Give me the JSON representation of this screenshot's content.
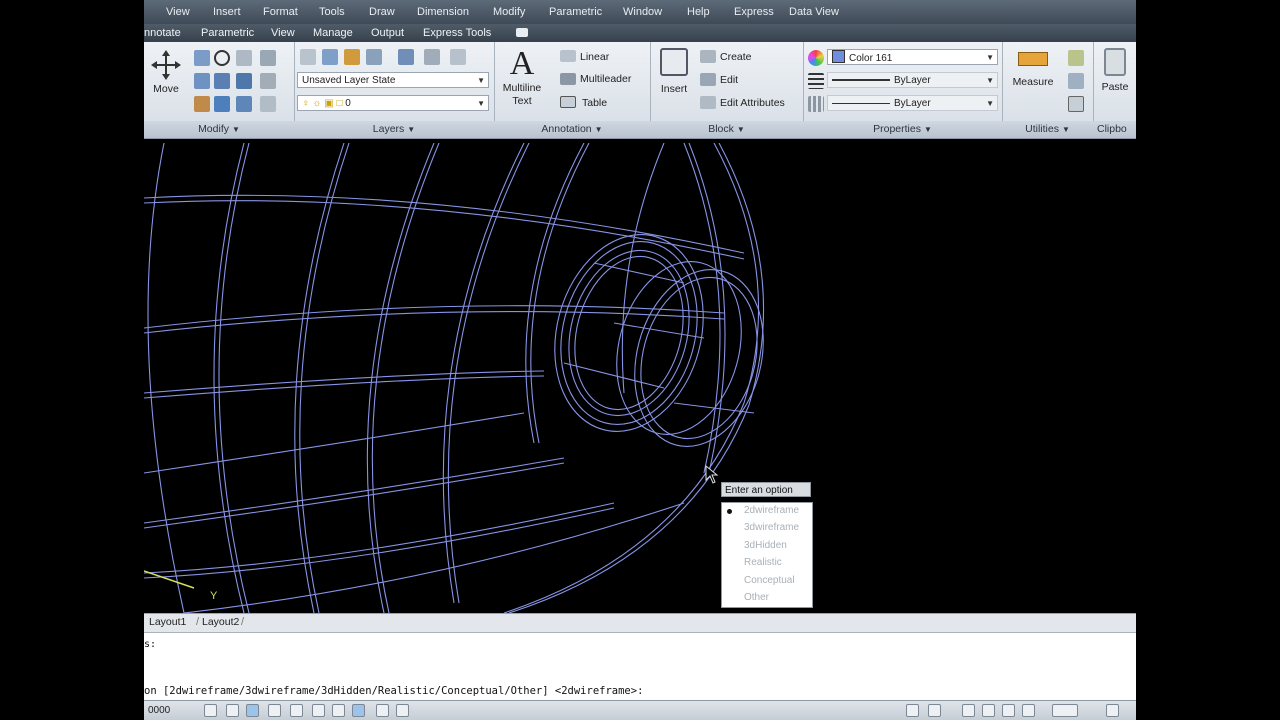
{
  "menu": [
    "View",
    "Insert",
    "Format",
    "Tools",
    "Draw",
    "Dimension",
    "Modify",
    "Parametric",
    "Window",
    "Help",
    "Express",
    "Data View"
  ],
  "tabs": [
    "nnotate",
    "Parametric",
    "View",
    "Manage",
    "Output",
    "Express Tools"
  ],
  "ribbon": {
    "modify": {
      "title": "Modify",
      "move_label": "Move"
    },
    "layers": {
      "title": "Layers",
      "layer_state": "Unsaved Layer State",
      "layer_name": "0"
    },
    "annotation": {
      "title": "Annotation",
      "multiline_text_line1": "Multiline",
      "multiline_text_line2": "Text",
      "linear": "Linear",
      "multileader": "Multileader",
      "table": "Table"
    },
    "block": {
      "title": "Block",
      "insert": "Insert",
      "create": "Create",
      "edit": "Edit",
      "edit_attributes": "Edit Attributes"
    },
    "properties": {
      "title": "Properties",
      "color": "Color 161",
      "linetype": "ByLayer",
      "lineweight": "ByLayer"
    },
    "utilities": {
      "title": "Utilities",
      "measure": "Measure"
    },
    "clipboard": {
      "title": "Clipbo",
      "paste": "Paste"
    }
  },
  "popup": {
    "title": "Enter an option",
    "options": [
      "2dwireframe",
      "3dwireframe",
      "3dHidden",
      "Realistic",
      "Conceptual",
      "Other"
    ],
    "selected_index": 0
  },
  "layout_tabs": [
    "Layout1",
    "Layout2"
  ],
  "command": {
    "history": "s:",
    "prompt": "on [2dwireframe/3dwireframe/3dHidden/Realistic/Conceptual/Other] <2dwireframe>:"
  },
  "status": {
    "coord": "0000"
  },
  "colors": {
    "wire": "#8f9cf2",
    "accent_color_swatch": "#6f8ee0",
    "axis_y": "#d8e05a"
  }
}
